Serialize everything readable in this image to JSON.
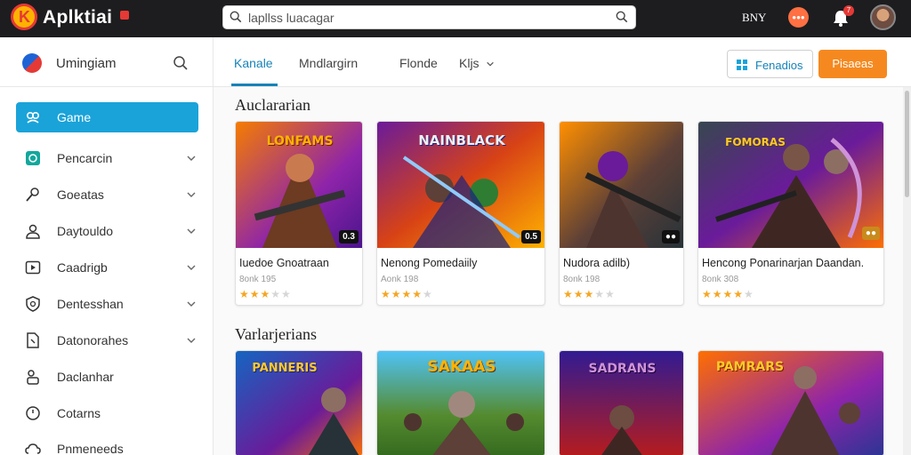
{
  "app": {
    "brand": "Aplktiai",
    "search_placeholder": "lapllss luacagar",
    "top_text": "BNY",
    "coin_label": "●●●",
    "notif_count": "7"
  },
  "sidebar": {
    "title": "Umingiam",
    "items": [
      {
        "label": "Game",
        "icon": "puzzle-icon",
        "active": true
      },
      {
        "label": "Pencarcin",
        "icon": "tv-icon"
      },
      {
        "label": "Goeatas",
        "icon": "wrench-icon"
      },
      {
        "label": "Daytouldo",
        "icon": "person-icon"
      },
      {
        "label": "Caadrigb",
        "icon": "play-square-icon"
      },
      {
        "label": "Dentesshan",
        "icon": "shield-icon"
      },
      {
        "label": "Datonorahes",
        "icon": "document-icon"
      },
      {
        "label": "Daclanhar",
        "icon": "users-icon"
      },
      {
        "label": "Cotarns",
        "icon": "clock-icon"
      },
      {
        "label": "Pnmeneeds",
        "icon": "cloud-icon"
      }
    ]
  },
  "tabs": [
    {
      "label": "Kanale",
      "active": true
    },
    {
      "label": "Mndlargirn"
    },
    {
      "label": "Flonde"
    },
    {
      "label": "Kljs"
    }
  ],
  "buttons": {
    "secondary": "Fenadios",
    "primary": "Pisaeas"
  },
  "sections": [
    {
      "title": "Auclararian",
      "cards": [
        {
          "title": "Iuedoe Gnoatraan",
          "sub": "8onk 195",
          "rating": 3,
          "badge": "0.3",
          "art": "LONFAMS"
        },
        {
          "title": "Nenong Pomedaiily",
          "sub": "Aonk 198",
          "rating": 4,
          "badge": "0.5",
          "art": "NAINBLACK"
        },
        {
          "title": "Nudora adilb)",
          "sub": "8onk 198",
          "rating": 3,
          "badge": "●●",
          "art": ""
        },
        {
          "title": "Hencong Ponarinarjan Daandan.",
          "sub": "8onk 308",
          "rating": 4,
          "badge": "●●",
          "art": "FOMORAS"
        }
      ]
    },
    {
      "title": "Varlarjerians",
      "cards": [
        {
          "title": "",
          "sub": "",
          "rating": 0,
          "badge": "",
          "art": "PANNERIS"
        },
        {
          "title": "",
          "sub": "",
          "rating": 0,
          "badge": "",
          "art": "SAKAAS"
        },
        {
          "title": "",
          "sub": "",
          "rating": 0,
          "badge": "",
          "art": "SADRANS"
        },
        {
          "title": "",
          "sub": "",
          "rating": 0,
          "badge": "",
          "art": "PAMRARS"
        }
      ]
    }
  ],
  "colors": {
    "accent": "#1aa3d9",
    "tab_active": "#1583b8",
    "primary_button": "#f5891f",
    "topbar": "#1d1d1f",
    "star": "#f5a623"
  }
}
